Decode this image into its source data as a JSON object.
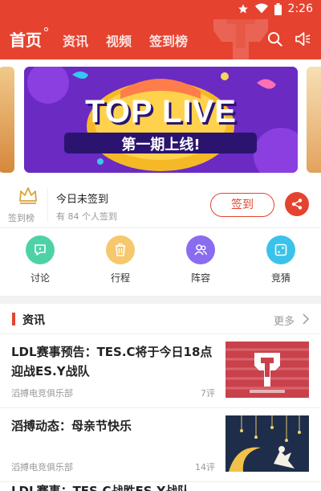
{
  "status_bar": {
    "time": "2:26"
  },
  "nav": {
    "tabs": [
      {
        "label": "首页"
      },
      {
        "label": "资讯"
      },
      {
        "label": "视频"
      },
      {
        "label": "签到榜"
      }
    ],
    "accent": "#e5432f"
  },
  "banner": {
    "title": "TOP LIVE",
    "subtitle": "第一期上线!"
  },
  "checkin": {
    "rank_label": "签到榜",
    "status": "今日未签到",
    "count_text": "有 84 个人签到",
    "button": "签到"
  },
  "quick_links": [
    {
      "label": "讨论",
      "icon": "chat-icon",
      "color": "#4fd1a7"
    },
    {
      "label": "行程",
      "icon": "trash-icon",
      "color": "#f7c76d"
    },
    {
      "label": "阵容",
      "icon": "people-icon",
      "color": "#8a6cf0"
    },
    {
      "label": "竞猜",
      "icon": "dice-icon",
      "color": "#3bc2ea"
    }
  ],
  "news": {
    "section_title": "资讯",
    "more": "更多",
    "items": [
      {
        "title": "LDL赛事预告：TES.C将于今日18点迎战ES.Y战队",
        "source": "滔搏电竞俱乐部",
        "comments": "7评"
      },
      {
        "title": "滔搏动态：母亲节快乐",
        "source": "滔搏电竞俱乐部",
        "comments": "14评"
      }
    ],
    "partial_title": "LDL赛事：TES.C战胜ES.Y战队"
  }
}
